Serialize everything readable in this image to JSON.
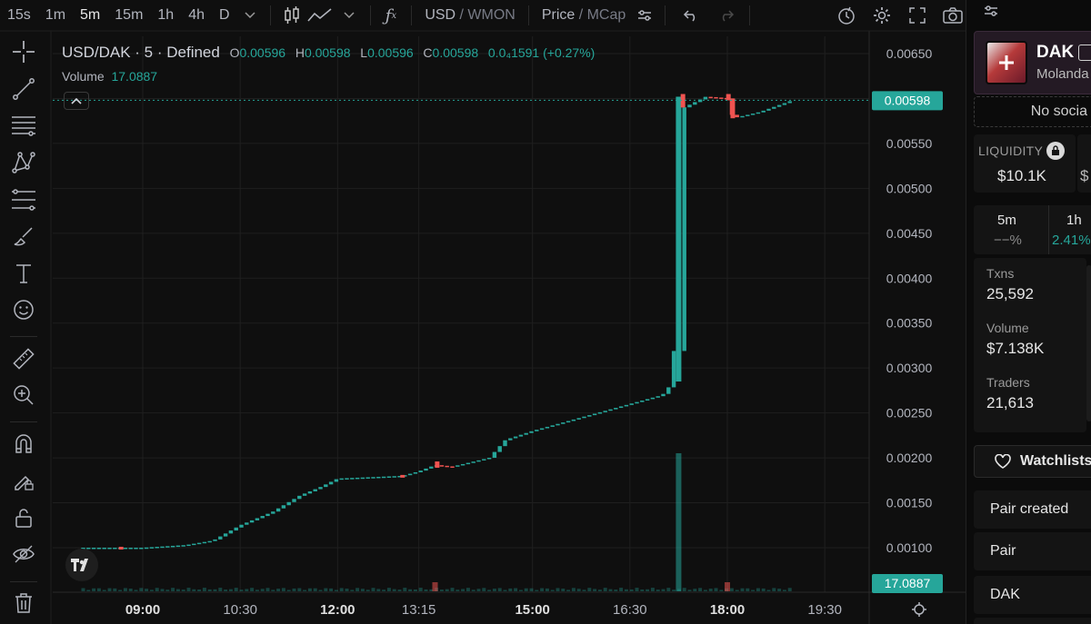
{
  "topbar": {
    "timeframes": [
      "15s",
      "1m",
      "5m",
      "15m",
      "1h",
      "4h",
      "D"
    ],
    "active_timeframe": "5m",
    "currency_main": "USD",
    "currency_alt": " / WMON",
    "mode_main": "Price",
    "mode_alt": " / MCap"
  },
  "legend": {
    "symbol": "USD/DAK · 5 · Defined",
    "o_label": "O",
    "o_value": "0.00596",
    "h_label": "H",
    "h_value": "0.00598",
    "l_label": "L",
    "l_value": "0.00596",
    "c_label": "C",
    "c_value": "0.00598",
    "change": "0.0₄1591 (+0.27%)",
    "volume_label": "Volume",
    "volume_value": "17.0887"
  },
  "price_axis": {
    "ticks": [
      "0.00650",
      "0.00600",
      "0.00550",
      "0.00500",
      "0.00450",
      "0.00400",
      "0.00350",
      "0.00300",
      "0.00250",
      "0.00200",
      "0.00150",
      "0.00100"
    ],
    "current_price": "0.00598",
    "current_volume": "17.0887"
  },
  "time_axis": {
    "labels": [
      "09:00",
      "10:30",
      "12:00",
      "13:15",
      "15:00",
      "16:30",
      "18:00",
      "19:30"
    ],
    "bold": [
      "09:00",
      "12:00",
      "15:00",
      "18:00"
    ]
  },
  "chart_data": {
    "type": "candlestick",
    "ylim": [
      0.00075,
      0.0066
    ],
    "current_price": 0.00598,
    "price_series": [
      {
        "t": "08:05",
        "p": 0.001
      },
      {
        "t": "09:00",
        "p": 0.001
      },
      {
        "t": "09:40",
        "p": 0.00103
      },
      {
        "t": "10:05",
        "p": 0.00108
      },
      {
        "t": "10:30",
        "p": 0.00125
      },
      {
        "t": "11:00",
        "p": 0.0014
      },
      {
        "t": "11:25",
        "p": 0.00158
      },
      {
        "t": "11:45",
        "p": 0.00168
      },
      {
        "t": "12:00",
        "p": 0.00177
      },
      {
        "t": "13:00",
        "p": 0.0018
      },
      {
        "t": "13:15",
        "p": 0.00185
      },
      {
        "t": "13:30",
        "p": 0.00192
      },
      {
        "t": "13:45",
        "p": 0.0019
      },
      {
        "t": "14:20",
        "p": 0.002
      },
      {
        "t": "14:35",
        "p": 0.0022
      },
      {
        "t": "15:00",
        "p": 0.0023
      },
      {
        "t": "16:00",
        "p": 0.0025
      },
      {
        "t": "17:00",
        "p": 0.0027
      },
      {
        "t": "17:10",
        "p": 0.00285
      },
      {
        "t": "17:15",
        "p": 0.00598
      },
      {
        "t": "17:20",
        "p": 0.0059
      },
      {
        "t": "17:40",
        "p": 0.00602
      },
      {
        "t": "18:00",
        "p": 0.006
      },
      {
        "t": "18:05",
        "p": 0.00578
      },
      {
        "t": "18:30",
        "p": 0.00585
      },
      {
        "t": "19:00",
        "p": 0.00598
      }
    ],
    "down_candles": [
      {
        "t": "08:40",
        "o": 0.00101,
        "c": 0.001
      },
      {
        "t": "13:00",
        "o": 0.00181,
        "c": 0.00179
      },
      {
        "t": "13:32",
        "o": 0.00196,
        "c": 0.00189
      },
      {
        "t": "17:19",
        "o": 0.00605,
        "c": 0.0059
      },
      {
        "t": "18:01",
        "o": 0.00605,
        "c": 0.00598
      },
      {
        "t": "18:05",
        "o": 0.006,
        "c": 0.00578
      }
    ],
    "volume_spikes": [
      {
        "t": "17:15",
        "v": "large"
      },
      {
        "t": "13:30",
        "v": "small"
      },
      {
        "t": "18:00",
        "v": "small"
      }
    ]
  },
  "right_panel": {
    "token_symbol": "DAK",
    "token_subtitle": "Molanda",
    "no_socials": "No socia",
    "liquidity_label": "LIQUIDITY",
    "liquidity_value": "$10.1K",
    "second_value_prefix": "$",
    "tf1_label": "5m",
    "tf1_value": "−−%",
    "tf2_label": "1h",
    "tf2_value": "2.41%",
    "txns_label": "Txns",
    "txns_value": "25,592",
    "volume_label": "Volume",
    "volume_value": "$7.138K",
    "traders_label": "Traders",
    "traders_value": "21,613",
    "watchlist_label": "Watchlists",
    "pair_created_label": "Pair created",
    "pair_label": "Pair",
    "dak_label": "DAK",
    "colors": {
      "up": "#26a69a",
      "down": "#ef5350",
      "accent_card": "#2a1e2a"
    }
  }
}
